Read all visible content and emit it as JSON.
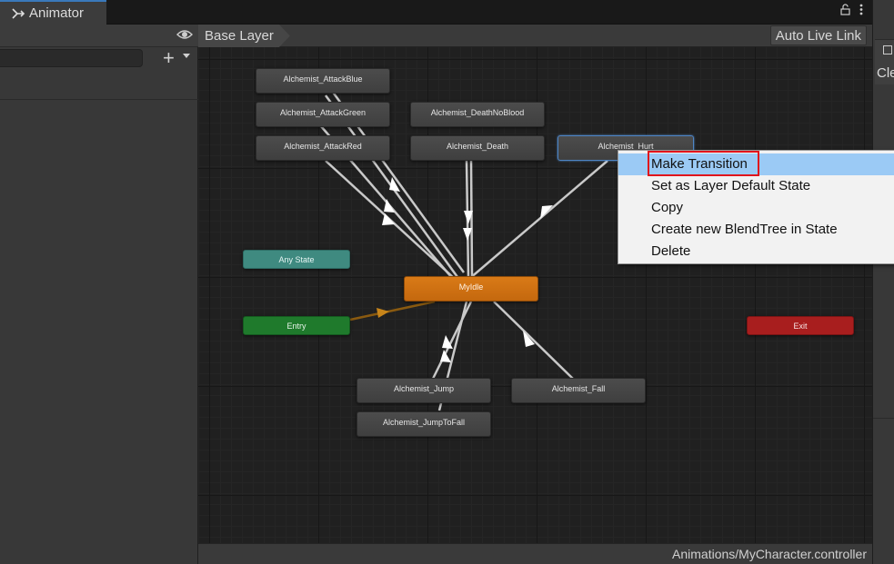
{
  "tab": {
    "title": "Animator",
    "icon": "animator-icon"
  },
  "tabbar_controls": {
    "lock_icon": "lock-icon",
    "more_icon": "kebab-menu-icon"
  },
  "left_panel": {
    "eye_icon": "eye-icon",
    "search_placeholder": "",
    "add_label": "+"
  },
  "graph": {
    "breadcrumb": "Base Layer",
    "auto_live_link": "Auto Live Link",
    "status_path": "Animations/MyCharacter.controller"
  },
  "right_panel": {
    "label": "Cle"
  },
  "nodes": {
    "attack_blue": "Alchemist_AttackBlue",
    "attack_green": "Alchemist_AttackGreen",
    "attack_red": "Alchemist_AttackRed",
    "death_no_blood": "Alchemist_DeathNoBlood",
    "death": "Alchemist_Death",
    "hurt": "Alchemist_Hurt",
    "any_state": "Any State",
    "my_idle": "MyIdle",
    "entry": "Entry",
    "exit": "Exit",
    "jump": "Alchemist_Jump",
    "jump_to_fall": "Alchemist_JumpToFall",
    "fall": "Alchemist_Fall"
  },
  "context_menu": {
    "items": [
      "Make Transition",
      "Set as Layer Default State",
      "Copy",
      "Create new BlendTree in State",
      "Delete"
    ],
    "hovered_index": 0
  },
  "colors": {
    "default_state": "#d97a17",
    "entry": "#1f7a2c",
    "exit": "#a81e1e",
    "any_state": "#3f8a80",
    "menu_hover": "#9bcaf5",
    "highlight_border": "#e0141c",
    "tab_accent": "#3a79bb"
  }
}
